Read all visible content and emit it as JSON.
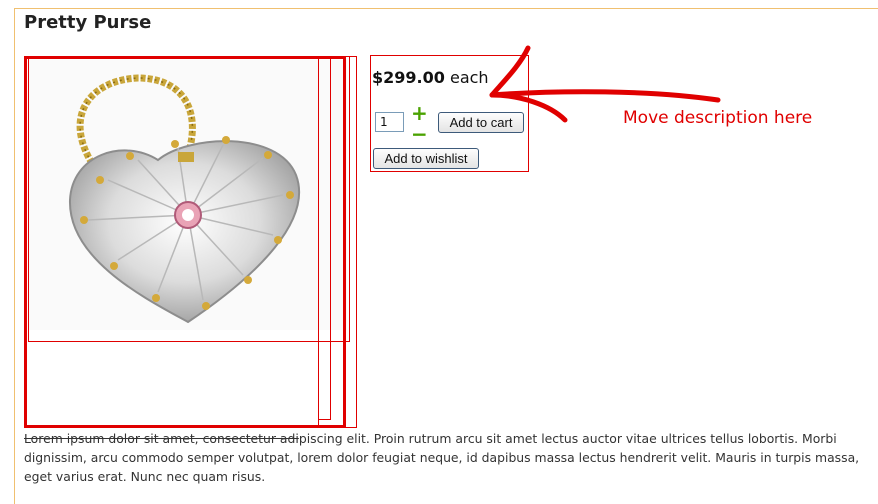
{
  "product": {
    "title": "Pretty Purse",
    "price_amount": "$299.00",
    "price_unit": "each",
    "quantity": "1",
    "increase_symbol": "+",
    "decrease_symbol": "−",
    "add_to_cart_label": "Add to cart",
    "add_to_wishlist_label": "Add to wishlist",
    "image_icon": "diamond-purse-image"
  },
  "annotation": {
    "text": "Move description here",
    "color": "#e00000"
  },
  "description": {
    "struck_part": "Lorem ipsum dolor sit amet, consectetur adi",
    "rest": "piscing elit. Proin rutrum arcu sit amet lectus auctor vitae ultrices tellus lobortis. Morbi dignissim, arcu commodo semper volutpat, lorem dolor feugiat neque, id dapibus massa lectus hendrerit velit. Mauris in turpis massa, eget varius erat. Nunc nec quam risus."
  },
  "colors": {
    "frame": "#f0c070",
    "stepper": "#4aa200",
    "annotation_red": "#e00000"
  }
}
